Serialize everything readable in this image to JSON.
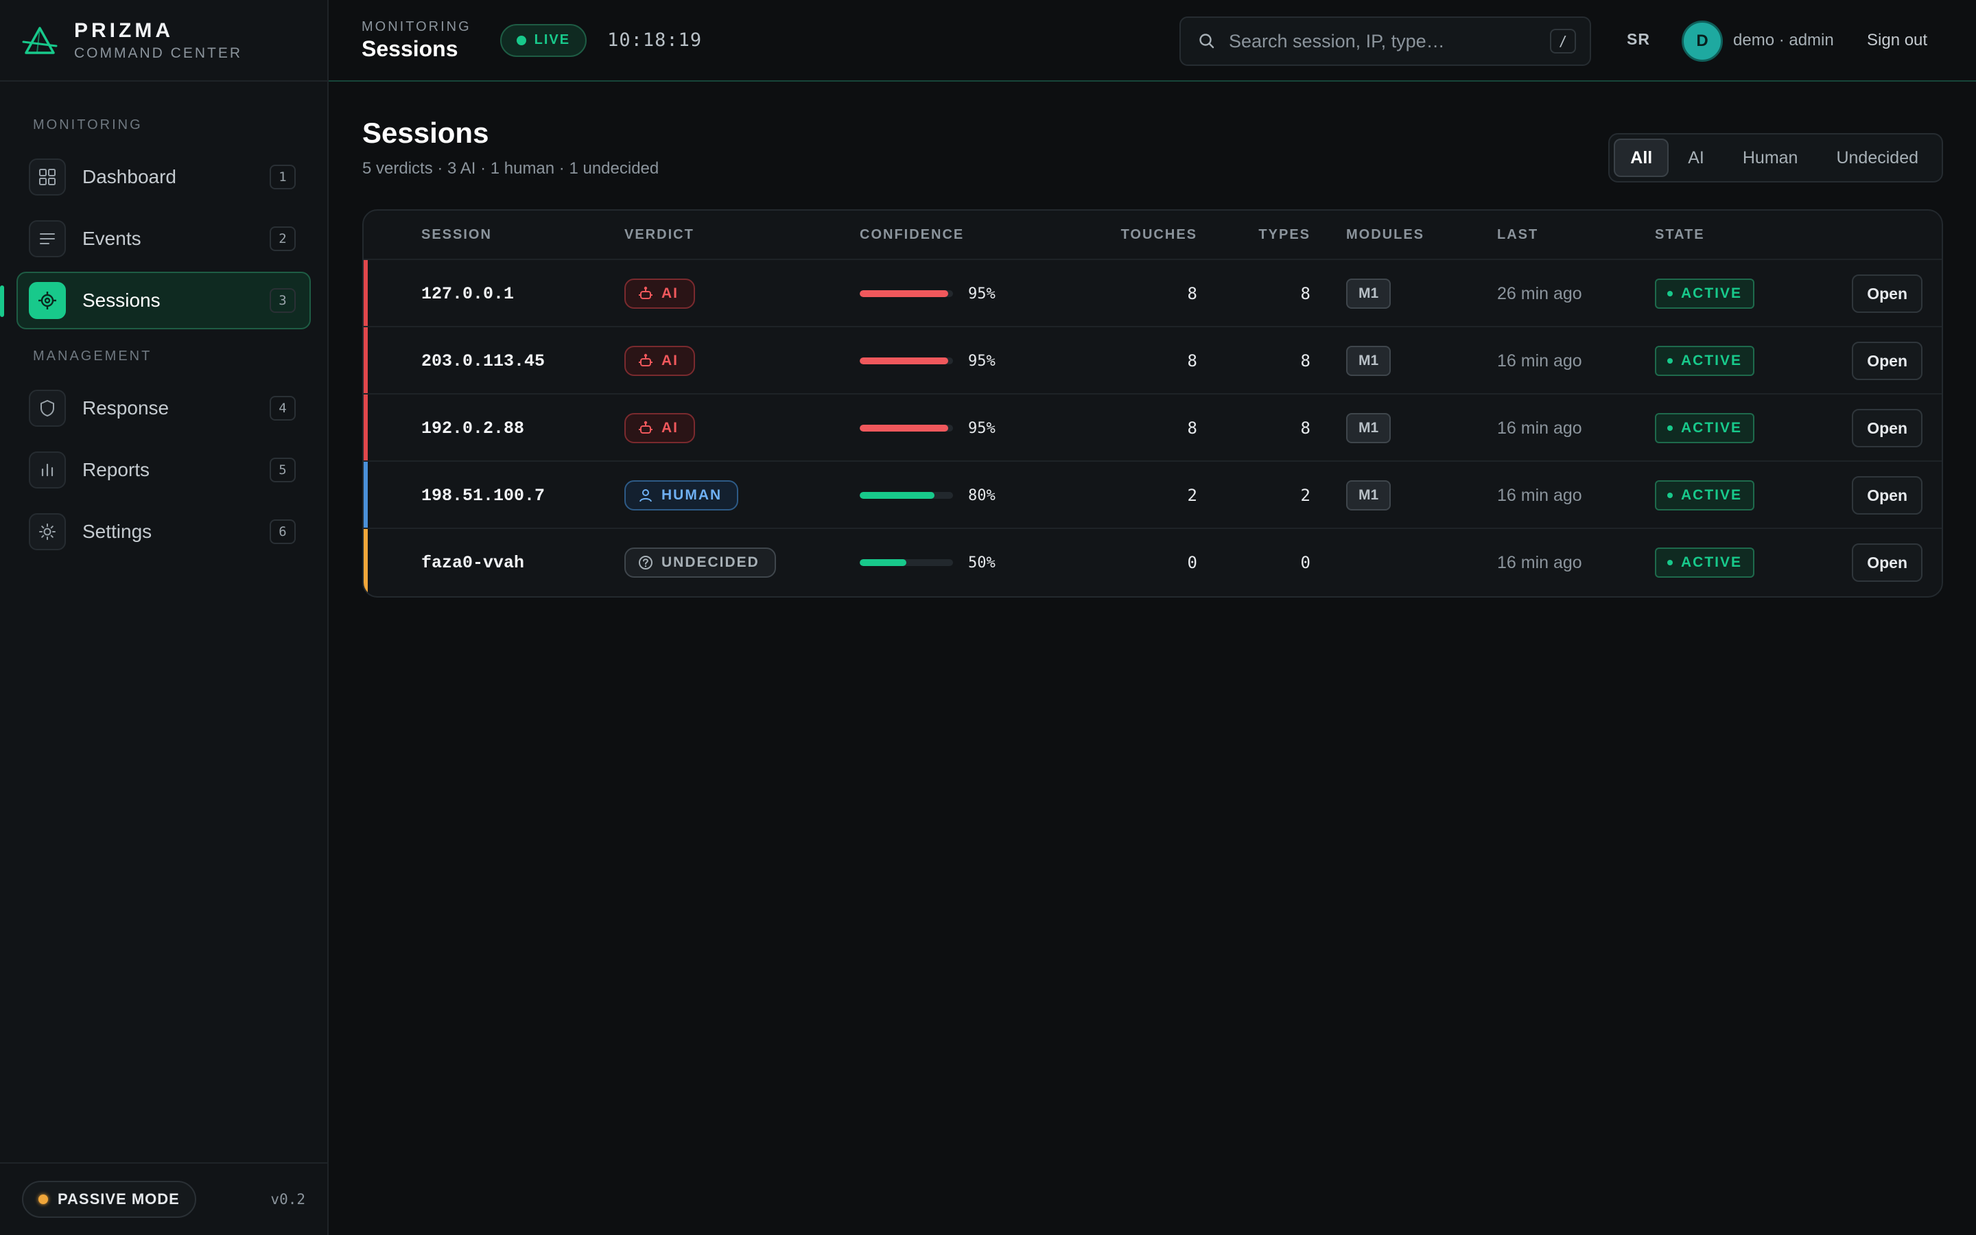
{
  "brand": {
    "name": "PRIZMA",
    "subtitle": "COMMAND CENTER"
  },
  "sidebar": {
    "sections": [
      "MONITORING",
      "MANAGEMENT"
    ],
    "items": [
      {
        "label": "Dashboard",
        "key": "1",
        "icon": "grid-icon"
      },
      {
        "label": "Events",
        "key": "2",
        "icon": "list-icon"
      },
      {
        "label": "Sessions",
        "key": "3",
        "icon": "target-icon",
        "active": true
      },
      {
        "label": "Response",
        "key": "4",
        "icon": "shield-icon"
      },
      {
        "label": "Reports",
        "key": "5",
        "icon": "bar-chart-icon"
      },
      {
        "label": "Settings",
        "key": "6",
        "icon": "gear-icon"
      }
    ],
    "footer": {
      "mode": "PASSIVE MODE",
      "version": "v0.2"
    }
  },
  "header": {
    "kicker": "MONITORING",
    "title": "Sessions",
    "live": "LIVE",
    "clock": "10:18:19",
    "search": {
      "placeholder": "Search session, IP, type…",
      "shortcut": "/"
    },
    "initials": "SR",
    "avatar": "D",
    "user": "demo · admin",
    "signout": "Sign out"
  },
  "main": {
    "title": "Sessions",
    "subtitle": "5 verdicts · 3 AI · 1 human · 1 undecided",
    "filters": [
      "All",
      "AI",
      "Human",
      "Undecided"
    ],
    "active_filter": "All"
  },
  "table": {
    "columns": [
      "SESSION",
      "VERDICT",
      "CONFIDENCE",
      "TOUCHES",
      "TYPES",
      "MODULES",
      "LAST",
      "STATE"
    ],
    "open_label": "Open",
    "rows": [
      {
        "session": "127.0.0.1",
        "verdict": "AI",
        "confidence": "95%",
        "confidence_value": 0.95,
        "touches": "8",
        "types": "8",
        "module": "M1",
        "last": "26 min ago",
        "state": "ACTIVE"
      },
      {
        "session": "203.0.113.45",
        "verdict": "AI",
        "confidence": "95%",
        "confidence_value": 0.95,
        "touches": "8",
        "types": "8",
        "module": "M1",
        "last": "16 min ago",
        "state": "ACTIVE"
      },
      {
        "session": "192.0.2.88",
        "verdict": "AI",
        "confidence": "95%",
        "confidence_value": 0.95,
        "touches": "8",
        "types": "8",
        "module": "M1",
        "last": "16 min ago",
        "state": "ACTIVE"
      },
      {
        "session": "198.51.100.7",
        "verdict": "HUMAN",
        "confidence": "80%",
        "confidence_value": 0.8,
        "touches": "2",
        "types": "2",
        "module": "M1",
        "last": "16 min ago",
        "state": "ACTIVE"
      },
      {
        "session": "faza0-vvah",
        "verdict": "UNDECIDED",
        "confidence": "50%",
        "confidence_value": 0.5,
        "touches": "0",
        "types": "0",
        "module": "",
        "last": "16 min ago",
        "state": "ACTIVE"
      }
    ]
  },
  "colors": {
    "accent": "#18c98b",
    "ai": "#f0585c",
    "human": "#4a90d9",
    "undecided": "#f0a63a",
    "background": "#0d0f11"
  }
}
